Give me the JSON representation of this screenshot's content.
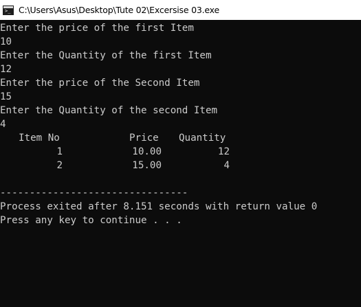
{
  "window": {
    "title": "C:\\Users\\Asus\\Desktop\\Tute 02\\Excersise 03.exe",
    "icon": "console-icon"
  },
  "console": {
    "prompts": [
      "Enter the price of the first Item",
      "10",
      "Enter the Quantity of the first Item",
      "12",
      "Enter the price of the Second Item",
      "15",
      "Enter the Quantity of the second Item",
      "4"
    ],
    "table": {
      "headers": [
        "Item No",
        "Price",
        "Quantity"
      ],
      "rows": [
        [
          "1",
          "10.00",
          "12"
        ],
        [
          "2",
          "15.00",
          "4"
        ]
      ]
    },
    "separator": "--------------------------------",
    "exit_message": "Process exited after 8.151 seconds with return value 0",
    "continue_message": "Press any key to continue . . ."
  },
  "colors": {
    "background": "#0c0c0c",
    "text": "#cccccc",
    "titlebar": "#ffffff"
  }
}
